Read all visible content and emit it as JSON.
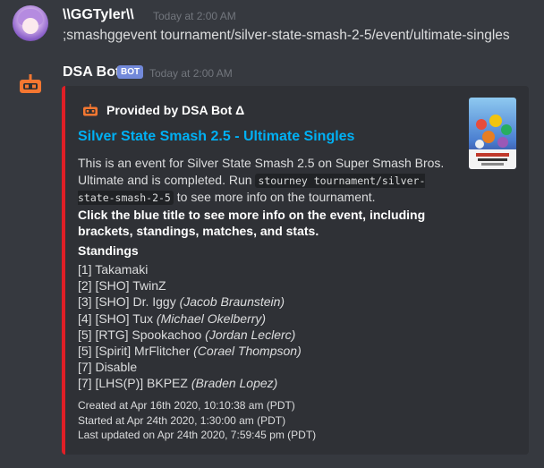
{
  "messages": [
    {
      "username": "\\\\GGTyler\\\\",
      "timestamp": "Today at 2:00 AM",
      "content": ";smashggevent tournament/silver-state-smash-2-5/event/ultimate-singles"
    },
    {
      "username": "DSA Bot",
      "badge": "BOT",
      "timestamp": "Today at 2:00 AM"
    }
  ],
  "embed": {
    "accent_color": "#e01f26",
    "author": "Provided by DSA Bot Δ",
    "author_icon": "robot-icon",
    "title": "Silver State Smash 2.5 - Ultimate Singles",
    "description": {
      "part1": "This is an event for Silver State Smash 2.5 on Super Smash Bros. Ultimate and is completed. Run ",
      "code": "stourney tournament/silver-state-smash-2-5",
      "part2": " to see more info on the tournament.",
      "bold": "Click the blue title to see more info on the event, including brackets, standings, matches, and stats."
    },
    "standings_title": "Standings",
    "standings": [
      {
        "text": "[1] Takamaki",
        "real": ""
      },
      {
        "text": "[2] [SHO] TwinZ",
        "real": ""
      },
      {
        "text": "[3] [SHO] Dr. Iggy ",
        "real": "(Jacob Braunstein)"
      },
      {
        "text": "[4] [SHO] Tux ",
        "real": "(Michael Okelberry)"
      },
      {
        "text": "[5] [RTG] Spookachoo ",
        "real": "(Jordan Leclerc)"
      },
      {
        "text": "[5] [Spirit] MrFlitcher ",
        "real": "(Corael Thompson)"
      },
      {
        "text": "[7] Disable",
        "real": ""
      },
      {
        "text": "[7] [LHS(P)] BKPEZ ",
        "real": "(Braden Lopez)"
      }
    ],
    "footer": {
      "created": "Created at Apr 16th 2020, 10:10:38 am (PDT)",
      "started": "Started at Apr 24th 2020, 1:30:00 am (PDT)",
      "updated": "Last updated on Apr 24th 2020, 7:59:45 pm (PDT)"
    }
  }
}
